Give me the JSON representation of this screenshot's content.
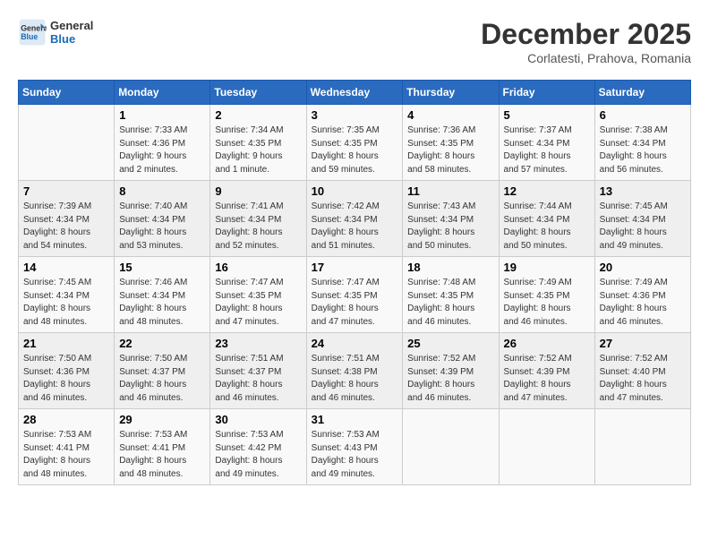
{
  "logo": {
    "line1": "General",
    "line2": "Blue"
  },
  "title": "December 2025",
  "subtitle": "Corlatesti, Prahova, Romania",
  "days_of_week": [
    "Sunday",
    "Monday",
    "Tuesday",
    "Wednesday",
    "Thursday",
    "Friday",
    "Saturday"
  ],
  "weeks": [
    [
      {
        "day": "",
        "info": ""
      },
      {
        "day": "1",
        "info": "Sunrise: 7:33 AM\nSunset: 4:36 PM\nDaylight: 9 hours\nand 2 minutes."
      },
      {
        "day": "2",
        "info": "Sunrise: 7:34 AM\nSunset: 4:35 PM\nDaylight: 9 hours\nand 1 minute."
      },
      {
        "day": "3",
        "info": "Sunrise: 7:35 AM\nSunset: 4:35 PM\nDaylight: 8 hours\nand 59 minutes."
      },
      {
        "day": "4",
        "info": "Sunrise: 7:36 AM\nSunset: 4:35 PM\nDaylight: 8 hours\nand 58 minutes."
      },
      {
        "day": "5",
        "info": "Sunrise: 7:37 AM\nSunset: 4:34 PM\nDaylight: 8 hours\nand 57 minutes."
      },
      {
        "day": "6",
        "info": "Sunrise: 7:38 AM\nSunset: 4:34 PM\nDaylight: 8 hours\nand 56 minutes."
      }
    ],
    [
      {
        "day": "7",
        "info": "Sunrise: 7:39 AM\nSunset: 4:34 PM\nDaylight: 8 hours\nand 54 minutes."
      },
      {
        "day": "8",
        "info": "Sunrise: 7:40 AM\nSunset: 4:34 PM\nDaylight: 8 hours\nand 53 minutes."
      },
      {
        "day": "9",
        "info": "Sunrise: 7:41 AM\nSunset: 4:34 PM\nDaylight: 8 hours\nand 52 minutes."
      },
      {
        "day": "10",
        "info": "Sunrise: 7:42 AM\nSunset: 4:34 PM\nDaylight: 8 hours\nand 51 minutes."
      },
      {
        "day": "11",
        "info": "Sunrise: 7:43 AM\nSunset: 4:34 PM\nDaylight: 8 hours\nand 50 minutes."
      },
      {
        "day": "12",
        "info": "Sunrise: 7:44 AM\nSunset: 4:34 PM\nDaylight: 8 hours\nand 50 minutes."
      },
      {
        "day": "13",
        "info": "Sunrise: 7:45 AM\nSunset: 4:34 PM\nDaylight: 8 hours\nand 49 minutes."
      }
    ],
    [
      {
        "day": "14",
        "info": "Sunrise: 7:45 AM\nSunset: 4:34 PM\nDaylight: 8 hours\nand 48 minutes."
      },
      {
        "day": "15",
        "info": "Sunrise: 7:46 AM\nSunset: 4:34 PM\nDaylight: 8 hours\nand 48 minutes."
      },
      {
        "day": "16",
        "info": "Sunrise: 7:47 AM\nSunset: 4:35 PM\nDaylight: 8 hours\nand 47 minutes."
      },
      {
        "day": "17",
        "info": "Sunrise: 7:47 AM\nSunset: 4:35 PM\nDaylight: 8 hours\nand 47 minutes."
      },
      {
        "day": "18",
        "info": "Sunrise: 7:48 AM\nSunset: 4:35 PM\nDaylight: 8 hours\nand 46 minutes."
      },
      {
        "day": "19",
        "info": "Sunrise: 7:49 AM\nSunset: 4:35 PM\nDaylight: 8 hours\nand 46 minutes."
      },
      {
        "day": "20",
        "info": "Sunrise: 7:49 AM\nSunset: 4:36 PM\nDaylight: 8 hours\nand 46 minutes."
      }
    ],
    [
      {
        "day": "21",
        "info": "Sunrise: 7:50 AM\nSunset: 4:36 PM\nDaylight: 8 hours\nand 46 minutes."
      },
      {
        "day": "22",
        "info": "Sunrise: 7:50 AM\nSunset: 4:37 PM\nDaylight: 8 hours\nand 46 minutes."
      },
      {
        "day": "23",
        "info": "Sunrise: 7:51 AM\nSunset: 4:37 PM\nDaylight: 8 hours\nand 46 minutes."
      },
      {
        "day": "24",
        "info": "Sunrise: 7:51 AM\nSunset: 4:38 PM\nDaylight: 8 hours\nand 46 minutes."
      },
      {
        "day": "25",
        "info": "Sunrise: 7:52 AM\nSunset: 4:39 PM\nDaylight: 8 hours\nand 46 minutes."
      },
      {
        "day": "26",
        "info": "Sunrise: 7:52 AM\nSunset: 4:39 PM\nDaylight: 8 hours\nand 47 minutes."
      },
      {
        "day": "27",
        "info": "Sunrise: 7:52 AM\nSunset: 4:40 PM\nDaylight: 8 hours\nand 47 minutes."
      }
    ],
    [
      {
        "day": "28",
        "info": "Sunrise: 7:53 AM\nSunset: 4:41 PM\nDaylight: 8 hours\nand 48 minutes."
      },
      {
        "day": "29",
        "info": "Sunrise: 7:53 AM\nSunset: 4:41 PM\nDaylight: 8 hours\nand 48 minutes."
      },
      {
        "day": "30",
        "info": "Sunrise: 7:53 AM\nSunset: 4:42 PM\nDaylight: 8 hours\nand 49 minutes."
      },
      {
        "day": "31",
        "info": "Sunrise: 7:53 AM\nSunset: 4:43 PM\nDaylight: 8 hours\nand 49 minutes."
      },
      {
        "day": "",
        "info": ""
      },
      {
        "day": "",
        "info": ""
      },
      {
        "day": "",
        "info": ""
      }
    ]
  ]
}
